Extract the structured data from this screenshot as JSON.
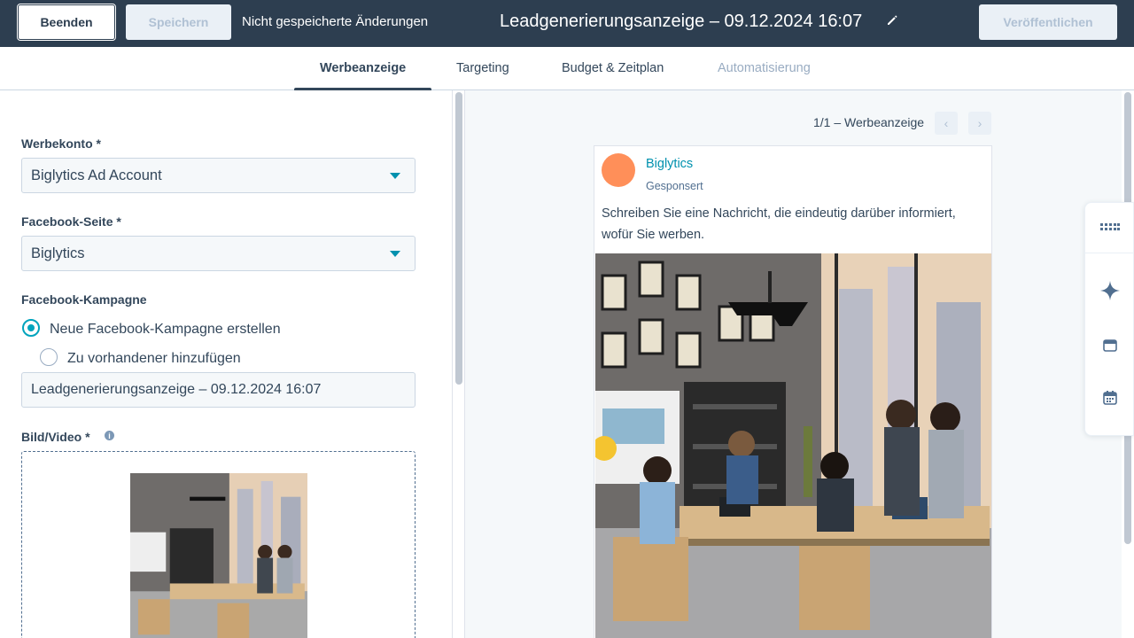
{
  "topbar": {
    "exit_label": "Beenden",
    "save_label": "Speichern",
    "unsaved_text": "Nicht gespeicherte Änderungen",
    "title": "Leadgenerierungsanzeige – 09.12.2024 16:07",
    "publish_label": "Veröffentlichen"
  },
  "tabs": [
    {
      "label": "Werbeanzeige",
      "state": "active"
    },
    {
      "label": "Targeting",
      "state": "normal"
    },
    {
      "label": "Budget & Zeitplan",
      "state": "normal"
    },
    {
      "label": "Automatisierung",
      "state": "disabled"
    }
  ],
  "form": {
    "ad_account": {
      "label": "Werbekonto *",
      "value": "Biglytics Ad Account"
    },
    "facebook_page": {
      "label": "Facebook-Seite *",
      "value": "Biglytics"
    },
    "campaign": {
      "label": "Facebook-Kampagne",
      "option_new": "Neue Facebook-Kampagne erstellen",
      "option_existing": "Zu vorhandener hinzufügen",
      "selected": "new",
      "name_value": "Leadgenerierungsanzeige – 09.12.2024 16:07"
    },
    "media": {
      "label": "Bild/Video *",
      "info_icon": "i"
    }
  },
  "preview": {
    "pager_text": "1/1 – Werbeanzeige",
    "prev_icon": "‹",
    "next_icon": "›",
    "page_name": "Biglytics",
    "sponsored": "Gesponsert",
    "message": "Schreiben Sie eine Nachricht, die eindeutig darüber informiert, wofür Sie werben."
  },
  "colors": {
    "topbar_bg": "#2d3e50",
    "accent": "#00a4bd",
    "link": "#0091ae",
    "avatar": "#ff8f59"
  }
}
